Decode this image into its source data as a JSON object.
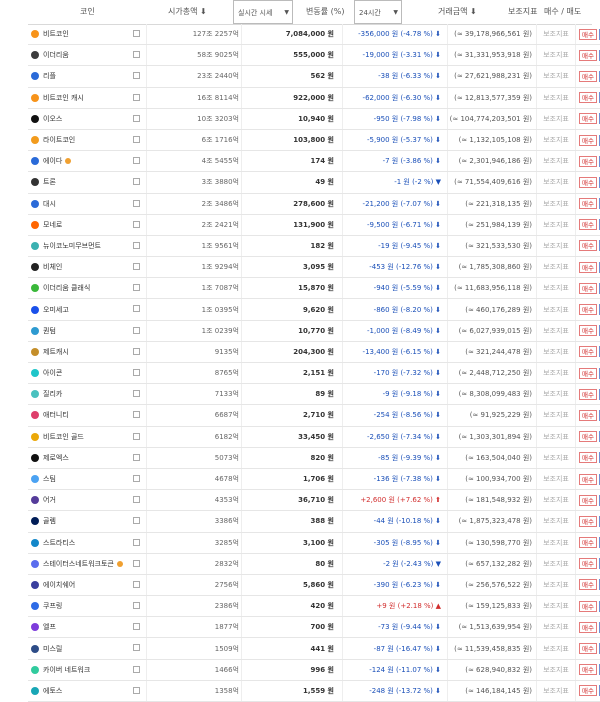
{
  "header": {
    "coin": "코인",
    "market_cap": "시가총액 ⬇",
    "price_select": "실시간 시세",
    "change": "변동률 (%)",
    "period_select": "24시간",
    "volume": "거래금액 ⬇",
    "indicator": "보조지표",
    "trade": "매수 / 매도"
  },
  "labels": {
    "indicator": "보조지표",
    "buy": "매수",
    "sell": "매도"
  },
  "colors": {
    "down": "#1a4fb8",
    "up": "#d12d2d"
  },
  "rows": [
    {
      "name": "비트코인",
      "cap": "127조 2257억",
      "price": "7,084,000 원",
      "change": "-356,000 원 (-4.78 %) ⬇",
      "dir": "down",
      "vol": "(≈ 39,178,966,561 원)",
      "icon": "#f7931a"
    },
    {
      "name": "이더리움",
      "cap": "58조 9025억",
      "price": "555,000 원",
      "change": "-19,000 원 (-3.31 %) ⬇",
      "dir": "down",
      "vol": "(≈ 31,331,953,918 원)",
      "icon": "#3c3c3d"
    },
    {
      "name": "리플",
      "cap": "23조 2440억",
      "price": "562 원",
      "change": "-38 원 (-6.33 %) ⬇",
      "dir": "down",
      "vol": "(≈ 27,621,988,231 원)",
      "icon": "#2a6ad8"
    },
    {
      "name": "비트코인 캐시",
      "cap": "16조 8114억",
      "price": "922,000 원",
      "change": "-62,000 원 (-6.30 %) ⬇",
      "dir": "down",
      "vol": "(≈ 12,813,577,359 원)",
      "icon": "#f7931a"
    },
    {
      "name": "이오스",
      "cap": "10조 3203억",
      "price": "10,940 원",
      "change": "-950 원 (-7.98 %) ⬇",
      "dir": "down",
      "vol": "(≈ 104,774,203,501 원)",
      "icon": "#111111"
    },
    {
      "name": "라이트코인",
      "cap": "6조 1716억",
      "price": "103,800 원",
      "change": "-5,900 원 (-5.37 %) ⬇",
      "dir": "down",
      "vol": "(≈ 1,132,105,108 원)",
      "icon": "#f29b1d"
    },
    {
      "name": "에이다",
      "star": true,
      "cap": "4조 5455억",
      "price": "174 원",
      "change": "-7 원 (-3.86 %) ⬇",
      "dir": "down",
      "vol": "(≈ 2,301,946,186 원)",
      "icon": "#2a6ad8"
    },
    {
      "name": "트론",
      "cap": "3조 3880억",
      "price": "49 원",
      "change": "-1 원 (-2 %) ▼",
      "dir": "down",
      "vol": "(≈ 71,554,409,616 원)",
      "icon": "#333333"
    },
    {
      "name": "대시",
      "cap": "2조 3486억",
      "price": "278,600 원",
      "change": "-21,200 원 (-7.07 %) ⬇",
      "dir": "down",
      "vol": "(≈ 221,318,135 원)",
      "icon": "#2a6ad8"
    },
    {
      "name": "모네로",
      "cap": "2조 2421억",
      "price": "131,900 원",
      "change": "-9,500 원 (-6.71 %) ⬇",
      "dir": "down",
      "vol": "(≈ 251,984,139 원)",
      "icon": "#ff6600"
    },
    {
      "name": "뉴이코노미무브먼트",
      "cap": "1조 9561억",
      "price": "182 원",
      "change": "-19 원 (-9.45 %) ⬇",
      "dir": "down",
      "vol": "(≈ 321,533,530 원)",
      "icon": "#3bb1b1"
    },
    {
      "name": "비체인",
      "cap": "1조 9294억",
      "price": "3,095 원",
      "change": "-453 원 (-12.76 %) ⬇",
      "dir": "down",
      "vol": "(≈ 1,785,308,860 원)",
      "icon": "#222222"
    },
    {
      "name": "이더리움 클래식",
      "cap": "1조 7087억",
      "price": "15,870 원",
      "change": "-940 원 (-5.59 %) ⬇",
      "dir": "down",
      "vol": "(≈ 11,683,956,118 원)",
      "icon": "#3ab83a"
    },
    {
      "name": "오미세고",
      "cap": "1조 0395억",
      "price": "9,620 원",
      "change": "-860 원 (-8.20 %) ⬇",
      "dir": "down",
      "vol": "(≈ 460,176,289 원)",
      "icon": "#1a50ea"
    },
    {
      "name": "퀀텀",
      "cap": "1조 0239억",
      "price": "10,770 원",
      "change": "-1,000 원 (-8.49 %) ⬇",
      "dir": "down",
      "vol": "(≈ 6,027,939,015 원)",
      "icon": "#2e9ad0"
    },
    {
      "name": "제트캐시",
      "cap": "9135억",
      "price": "204,300 원",
      "change": "-13,400 원 (-6.15 %) ⬇",
      "dir": "down",
      "vol": "(≈ 321,244,478 원)",
      "icon": "#c48e2a"
    },
    {
      "name": "아이콘",
      "cap": "8765억",
      "price": "2,151 원",
      "change": "-170 원 (-7.32 %) ⬇",
      "dir": "down",
      "vol": "(≈ 2,448,712,250 원)",
      "icon": "#1fc5c9"
    },
    {
      "name": "질리카",
      "cap": "7133억",
      "price": "89 원",
      "change": "-9 원 (-9.18 %) ⬇",
      "dir": "down",
      "vol": "(≈ 8,308,099,483 원)",
      "icon": "#49c1bf"
    },
    {
      "name": "애터니티",
      "cap": "6687억",
      "price": "2,710 원",
      "change": "-254 원 (-8.56 %) ⬇",
      "dir": "down",
      "vol": "(≈ 91,925,229 원)",
      "icon": "#de3f6b"
    },
    {
      "name": "비트코인 골드",
      "cap": "6182억",
      "price": "33,450 원",
      "change": "-2,650 원 (-7.34 %) ⬇",
      "dir": "down",
      "vol": "(≈ 1,303,301,894 원)",
      "icon": "#eba809"
    },
    {
      "name": "제로엑스",
      "cap": "5073억",
      "price": "820 원",
      "change": "-85 원 (-9.39 %) ⬇",
      "dir": "down",
      "vol": "(≈ 163,504,040 원)",
      "icon": "#111111"
    },
    {
      "name": "스팀",
      "cap": "4678억",
      "price": "1,706 원",
      "change": "-136 원 (-7.38 %) ⬇",
      "dir": "down",
      "vol": "(≈ 100,934,700 원)",
      "icon": "#4ba2f2"
    },
    {
      "name": "어거",
      "cap": "4353억",
      "price": "36,710 원",
      "change": "+2,600 원 (+7.62 %) ⬆",
      "dir": "up",
      "vol": "(≈ 181,548,932 원)",
      "icon": "#553c9a"
    },
    {
      "name": "골렘",
      "cap": "3386억",
      "price": "388 원",
      "change": "-44 원 (-10.18 %) ⬇",
      "dir": "down",
      "vol": "(≈ 1,875,323,478 원)",
      "icon": "#001d57"
    },
    {
      "name": "스트라티스",
      "cap": "3285억",
      "price": "3,100 원",
      "change": "-305 원 (-8.95 %) ⬇",
      "dir": "down",
      "vol": "(≈ 130,598,770 원)",
      "icon": "#1387c9"
    },
    {
      "name": "스테이터스네트워크토큰",
      "star": true,
      "cap": "2832억",
      "price": "80 원",
      "change": "-2 원 (-2.43 %) ▼",
      "dir": "down",
      "vol": "(≈ 657,132,282 원)",
      "icon": "#5b6dee"
    },
    {
      "name": "에이치쉐어",
      "cap": "2756억",
      "price": "5,860 원",
      "change": "-390 원 (-6.23 %) ⬇",
      "dir": "down",
      "vol": "(≈ 256,576,522 원)",
      "icon": "#3a3f9e"
    },
    {
      "name": "쿠프링",
      "cap": "2386억",
      "price": "420 원",
      "change": "+9 원 (+2.18 %) ▲",
      "dir": "up",
      "vol": "(≈ 159,125,833 원)",
      "icon": "#2e6be6"
    },
    {
      "name": "엘프",
      "cap": "1877억",
      "price": "700 원",
      "change": "-73 원 (-9.44 %) ⬇",
      "dir": "down",
      "vol": "(≈ 1,513,639,954 원)",
      "icon": "#7d3cdb"
    },
    {
      "name": "미스릴",
      "cap": "1509억",
      "price": "441 원",
      "change": "-87 원 (-16.47 %) ⬇",
      "dir": "down",
      "vol": "(≈ 11,539,458,835 원)",
      "icon": "#2d4c87"
    },
    {
      "name": "카이버 네트워크",
      "cap": "1466억",
      "price": "996 원",
      "change": "-124 원 (-11.07 %) ⬇",
      "dir": "down",
      "vol": "(≈ 628,940,832 원)",
      "icon": "#31cb9e"
    },
    {
      "name": "에토스",
      "cap": "1358억",
      "price": "1,559 원",
      "change": "-248 원 (-13.72 %) ⬇",
      "dir": "down",
      "vol": "(≈ 146,184,145 원)",
      "icon": "#18a6b5"
    }
  ]
}
